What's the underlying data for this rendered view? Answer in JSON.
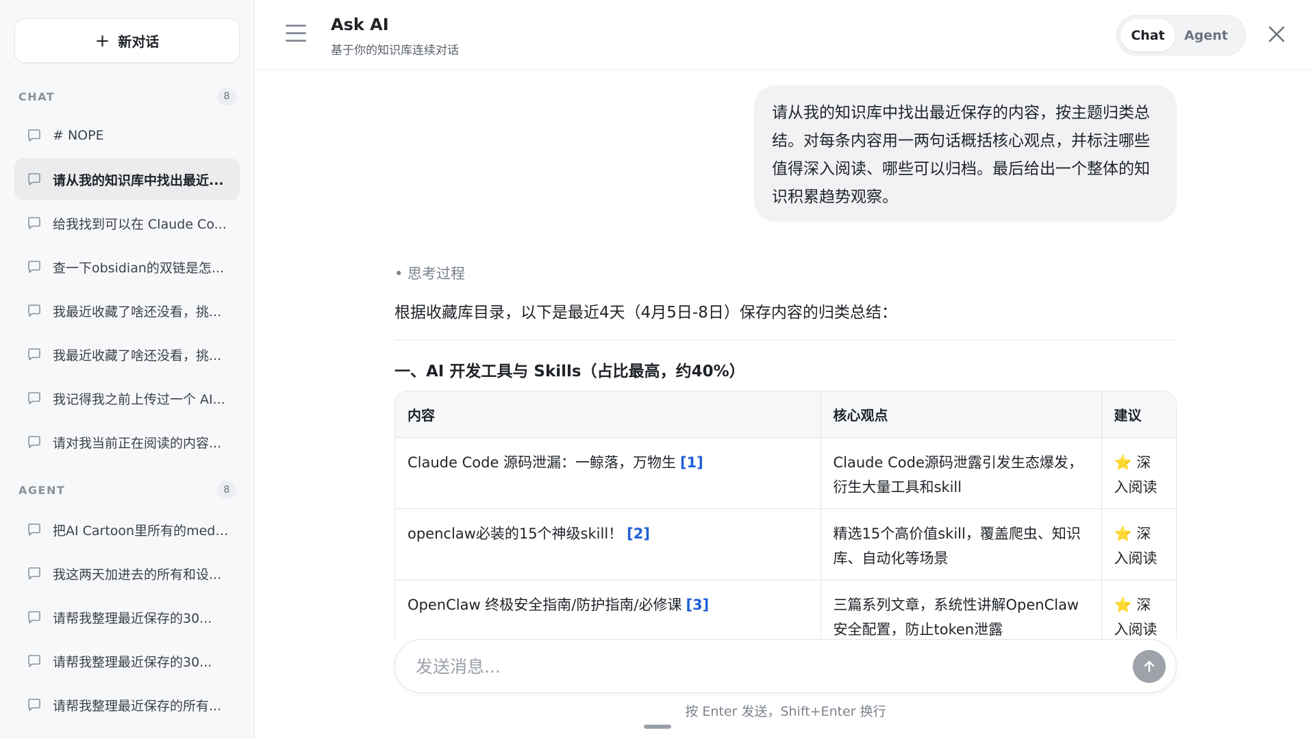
{
  "sidebar": {
    "new_chat_label": "新对话",
    "chat_section": {
      "title": "CHAT",
      "count": "8",
      "items": [
        {
          "label": "# NOPE"
        },
        {
          "label": "请从我的知识库中找出最近..."
        },
        {
          "label": "给我找到可以在 Claude Co..."
        },
        {
          "label": "查一下obsidian的双链是怎..."
        },
        {
          "label": "我最近收藏了啥还没看，挑..."
        },
        {
          "label": "我最近收藏了啥还没看，挑..."
        },
        {
          "label": "我记得我之前上传过一个 AI..."
        },
        {
          "label": "请对我当前正在阅读的内容..."
        }
      ]
    },
    "agent_section": {
      "title": "AGENT",
      "count": "8",
      "items": [
        {
          "label": "把AI Cartoon里所有的medi..."
        },
        {
          "label": "我这两天加进去的所有和设..."
        },
        {
          "label": "请帮我整理最近保存的30..."
        },
        {
          "label": "请帮我整理最近保存的30..."
        },
        {
          "label": "请帮我整理最近保存的所有..."
        }
      ]
    }
  },
  "header": {
    "title": "Ask AI",
    "subtitle": "基于你的知识库连续对话",
    "modes": [
      "Chat",
      "Agent"
    ],
    "active_mode": "Chat"
  },
  "conversation": {
    "user_message": "请从我的知识库中找出最近保存的内容，按主题归类总结。对每条内容用一两句话概括核心观点，并标注哪些值得深入阅读、哪些可以归档。最后给出一个整体的知识积累趋势观察。",
    "thinking_label": "• 思考过程",
    "intro": "根据收藏库目录，以下是最近4天（4月5日-8日）保存内容的归类总结：",
    "section_heading": "一、AI 开发工具与 Skills（占比最高，约40%）",
    "table": {
      "headers": [
        "内容",
        "核心观点",
        "建议"
      ],
      "rows": [
        {
          "content": "Claude Code 源码泄漏：一鲸落，万物生",
          "ref": "[1]",
          "summary": "Claude Code源码泄露引发生态爆发，衍生大量工具和skill",
          "suggestion": "⭐ 深入阅读"
        },
        {
          "content": "openclaw必装的15个神级skill！",
          "ref": "[2]",
          "summary": "精选15个高价值skill，覆盖爬虫、知识库、自动化等场景",
          "suggestion": "⭐ 深入阅读"
        },
        {
          "content": "OpenClaw 终极安全指南/防护指南/必修课",
          "ref": "[3]",
          "summary": "三篇系列文章，系统性讲解OpenClaw安全配置，防止token泄露",
          "suggestion": "⭐ 深入阅读"
        }
      ]
    }
  },
  "composer": {
    "placeholder": "发送消息...",
    "hint": "按 Enter 发送，Shift+Enter 换行"
  }
}
